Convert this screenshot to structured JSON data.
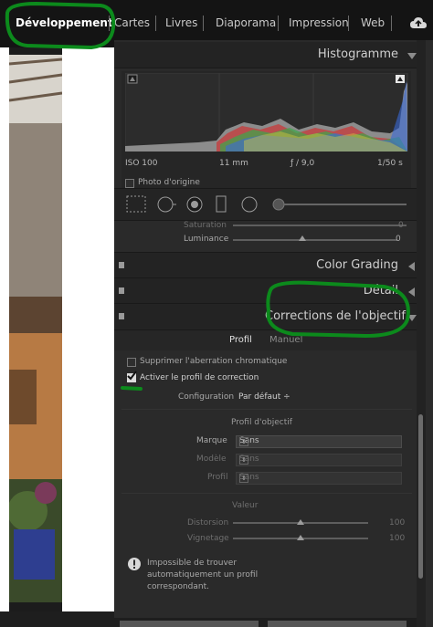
{
  "modules": [
    "Développement",
    "Cartes",
    "Livres",
    "Diaporama",
    "Impression",
    "Web"
  ],
  "histogram": {
    "title": "Histogramme",
    "iso": "ISO 100",
    "focal": "11 mm",
    "aperture": "ƒ / 9,0",
    "shutter": "1/50 s",
    "original_photo_label": "Photo d'origine"
  },
  "hsl": {
    "saturation_label": "Saturation",
    "saturation_value": "0",
    "luminance_label": "Luminance",
    "luminance_value": "0"
  },
  "panels": {
    "color_grading": "Color Grading",
    "detail": "Détail",
    "lens_corrections": "Corrections de l'objectif"
  },
  "lens": {
    "tab_profile": "Profil",
    "tab_manual": "Manuel",
    "remove_ca": "Supprimer l'aberration chromatique",
    "enable_profile": "Activer le profil de correction",
    "configuration_label": "Configuration",
    "configuration_value": "Par défaut ÷",
    "lens_profile_title": "Profil d'objectif",
    "make_label": "Marque",
    "make_value": "Sans",
    "model_label": "Modèle",
    "model_value": "Sans",
    "profile_label": "Profil",
    "profile_value": "Sans",
    "amount_title": "Valeur",
    "distortion_label": "Distorsion",
    "distortion_value": "100",
    "vignetting_label": "Vignetage",
    "vignetting_value": "100",
    "warning_line1": "Impossible de trouver",
    "warning_line2": "automatiquement un profil",
    "warning_line3": "correspondant."
  },
  "colors": {
    "annotation": "#0c8a1c",
    "panel_bg": "#2a2a2a",
    "header_bg": "#232323"
  }
}
